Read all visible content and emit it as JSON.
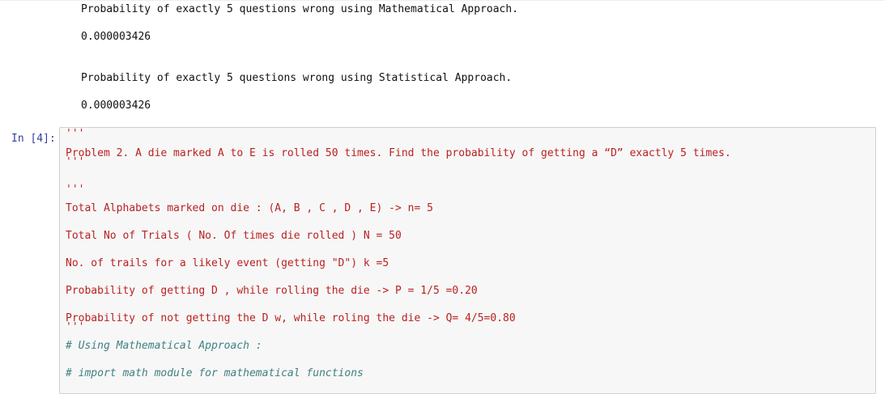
{
  "output": {
    "math_heading": "Probability of exactly 5 questions wrong using Mathematical Approach.",
    "math_value": "0.000003426",
    "stat_heading": "Probability of exactly 5 questions wrong using Statistical Approach.",
    "stat_value": "0.000003426"
  },
  "cell": {
    "prompt": "In [4]:",
    "lines": [
      "'''",
      "Problem 2. A die marked A to E is rolled 50 times. Find the probability of getting a “D” exactly 5 times.",
      "'''",
      "",
      "'''",
      "Total Alphabets marked on die : (A, B , C , D , E) -> n= 5",
      "",
      "Total No of Trials ( No. Of times die rolled ) N = 50",
      "",
      "No. of trails for a likely event (getting \"D\") k =5",
      "",
      "Probability of getting D , while rolling the die -> P = 1/5 =0.20",
      "",
      "Probability of not getting the D w, while roling the die -> Q= 4/5=0.80",
      "'''",
      "# Using Mathematical Approach :",
      "",
      "# import math module for mathematical functions"
    ]
  },
  "colors": {
    "string": "#ba2121",
    "comment": "#408080",
    "prompt": "#303f9f",
    "cell_background": "#f7f7f7",
    "cell_border": "#cfcfcf"
  }
}
